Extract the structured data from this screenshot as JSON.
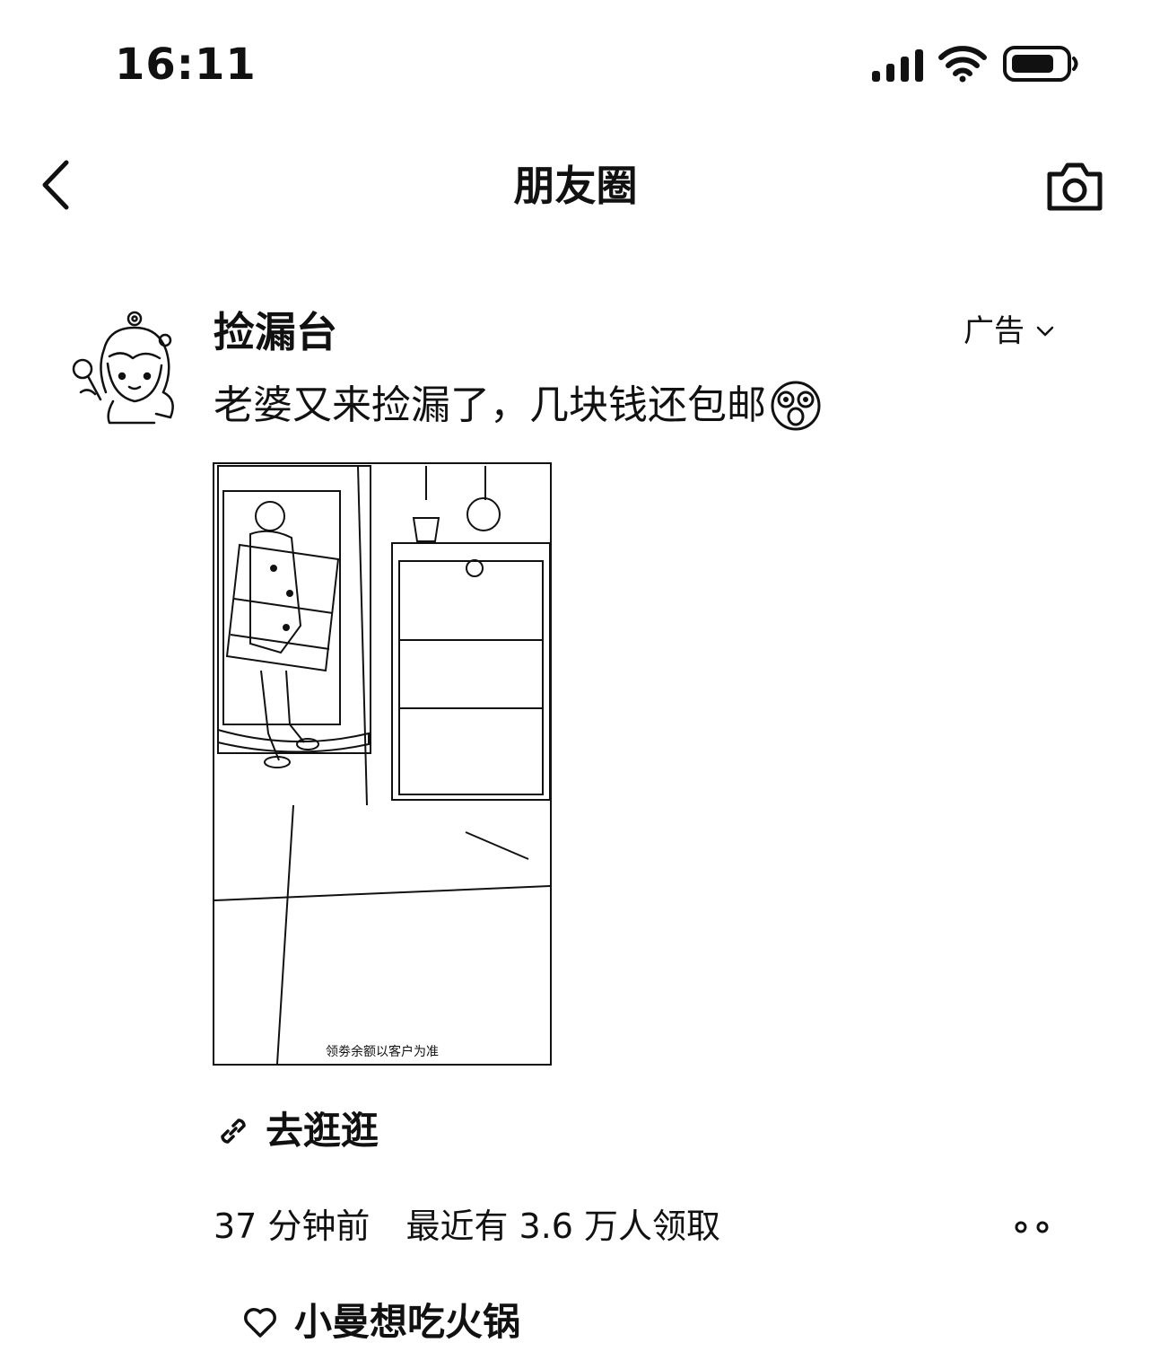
{
  "status_bar": {
    "time": "16:11"
  },
  "nav": {
    "title": "朋友圈"
  },
  "post": {
    "username": "捡漏台",
    "ad_label": "广告",
    "text": "老婆又来捡漏了，几块钱还包邮",
    "photo_caption": "领劵余额以客户为准",
    "link_label": "去逛逛",
    "time_ago": "37 分钟前",
    "claim_info": "最近有 3.6 万人领取",
    "liked_by": "小曼想吃火锅"
  },
  "icons": {
    "back": "chevron-left-icon",
    "camera": "camera-icon",
    "link": "link-icon",
    "more": "more-dots-icon",
    "like": "heart-icon"
  }
}
